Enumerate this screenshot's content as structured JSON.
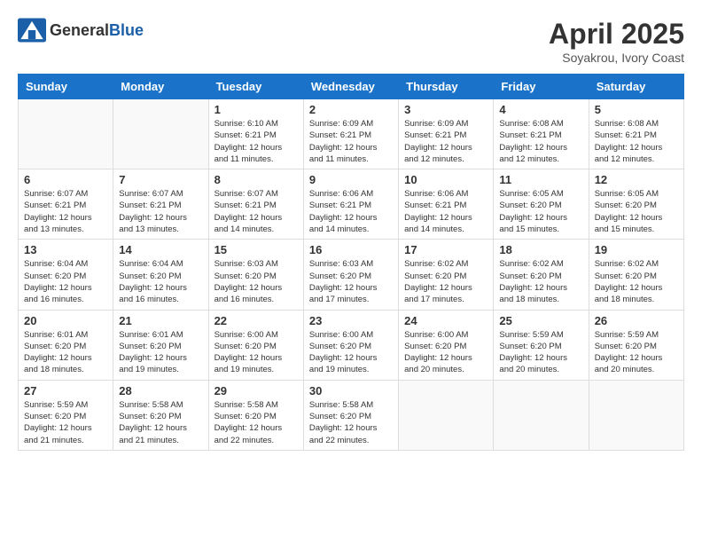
{
  "header": {
    "logo_general": "General",
    "logo_blue": "Blue",
    "month_year": "April 2025",
    "location": "Soyakrou, Ivory Coast"
  },
  "days_of_week": [
    "Sunday",
    "Monday",
    "Tuesday",
    "Wednesday",
    "Thursday",
    "Friday",
    "Saturday"
  ],
  "weeks": [
    [
      {
        "day": "",
        "info": ""
      },
      {
        "day": "",
        "info": ""
      },
      {
        "day": "1",
        "info": "Sunrise: 6:10 AM\nSunset: 6:21 PM\nDaylight: 12 hours and 11 minutes."
      },
      {
        "day": "2",
        "info": "Sunrise: 6:09 AM\nSunset: 6:21 PM\nDaylight: 12 hours and 11 minutes."
      },
      {
        "day": "3",
        "info": "Sunrise: 6:09 AM\nSunset: 6:21 PM\nDaylight: 12 hours and 12 minutes."
      },
      {
        "day": "4",
        "info": "Sunrise: 6:08 AM\nSunset: 6:21 PM\nDaylight: 12 hours and 12 minutes."
      },
      {
        "day": "5",
        "info": "Sunrise: 6:08 AM\nSunset: 6:21 PM\nDaylight: 12 hours and 12 minutes."
      }
    ],
    [
      {
        "day": "6",
        "info": "Sunrise: 6:07 AM\nSunset: 6:21 PM\nDaylight: 12 hours and 13 minutes."
      },
      {
        "day": "7",
        "info": "Sunrise: 6:07 AM\nSunset: 6:21 PM\nDaylight: 12 hours and 13 minutes."
      },
      {
        "day": "8",
        "info": "Sunrise: 6:07 AM\nSunset: 6:21 PM\nDaylight: 12 hours and 14 minutes."
      },
      {
        "day": "9",
        "info": "Sunrise: 6:06 AM\nSunset: 6:21 PM\nDaylight: 12 hours and 14 minutes."
      },
      {
        "day": "10",
        "info": "Sunrise: 6:06 AM\nSunset: 6:21 PM\nDaylight: 12 hours and 14 minutes."
      },
      {
        "day": "11",
        "info": "Sunrise: 6:05 AM\nSunset: 6:20 PM\nDaylight: 12 hours and 15 minutes."
      },
      {
        "day": "12",
        "info": "Sunrise: 6:05 AM\nSunset: 6:20 PM\nDaylight: 12 hours and 15 minutes."
      }
    ],
    [
      {
        "day": "13",
        "info": "Sunrise: 6:04 AM\nSunset: 6:20 PM\nDaylight: 12 hours and 16 minutes."
      },
      {
        "day": "14",
        "info": "Sunrise: 6:04 AM\nSunset: 6:20 PM\nDaylight: 12 hours and 16 minutes."
      },
      {
        "day": "15",
        "info": "Sunrise: 6:03 AM\nSunset: 6:20 PM\nDaylight: 12 hours and 16 minutes."
      },
      {
        "day": "16",
        "info": "Sunrise: 6:03 AM\nSunset: 6:20 PM\nDaylight: 12 hours and 17 minutes."
      },
      {
        "day": "17",
        "info": "Sunrise: 6:02 AM\nSunset: 6:20 PM\nDaylight: 12 hours and 17 minutes."
      },
      {
        "day": "18",
        "info": "Sunrise: 6:02 AM\nSunset: 6:20 PM\nDaylight: 12 hours and 18 minutes."
      },
      {
        "day": "19",
        "info": "Sunrise: 6:02 AM\nSunset: 6:20 PM\nDaylight: 12 hours and 18 minutes."
      }
    ],
    [
      {
        "day": "20",
        "info": "Sunrise: 6:01 AM\nSunset: 6:20 PM\nDaylight: 12 hours and 18 minutes."
      },
      {
        "day": "21",
        "info": "Sunrise: 6:01 AM\nSunset: 6:20 PM\nDaylight: 12 hours and 19 minutes."
      },
      {
        "day": "22",
        "info": "Sunrise: 6:00 AM\nSunset: 6:20 PM\nDaylight: 12 hours and 19 minutes."
      },
      {
        "day": "23",
        "info": "Sunrise: 6:00 AM\nSunset: 6:20 PM\nDaylight: 12 hours and 19 minutes."
      },
      {
        "day": "24",
        "info": "Sunrise: 6:00 AM\nSunset: 6:20 PM\nDaylight: 12 hours and 20 minutes."
      },
      {
        "day": "25",
        "info": "Sunrise: 5:59 AM\nSunset: 6:20 PM\nDaylight: 12 hours and 20 minutes."
      },
      {
        "day": "26",
        "info": "Sunrise: 5:59 AM\nSunset: 6:20 PM\nDaylight: 12 hours and 20 minutes."
      }
    ],
    [
      {
        "day": "27",
        "info": "Sunrise: 5:59 AM\nSunset: 6:20 PM\nDaylight: 12 hours and 21 minutes."
      },
      {
        "day": "28",
        "info": "Sunrise: 5:58 AM\nSunset: 6:20 PM\nDaylight: 12 hours and 21 minutes."
      },
      {
        "day": "29",
        "info": "Sunrise: 5:58 AM\nSunset: 6:20 PM\nDaylight: 12 hours and 22 minutes."
      },
      {
        "day": "30",
        "info": "Sunrise: 5:58 AM\nSunset: 6:20 PM\nDaylight: 12 hours and 22 minutes."
      },
      {
        "day": "",
        "info": ""
      },
      {
        "day": "",
        "info": ""
      },
      {
        "day": "",
        "info": ""
      }
    ]
  ]
}
